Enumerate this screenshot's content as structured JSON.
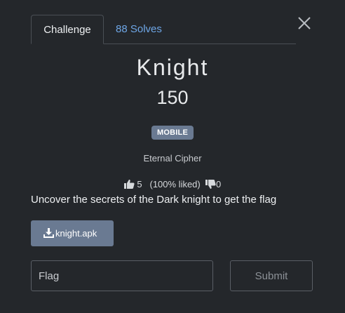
{
  "tabs": {
    "challenge_label": "Challenge",
    "solves_label": "88 Solves"
  },
  "challenge": {
    "name": "Knight",
    "points": "150",
    "tag": "MOBILE",
    "category": "Eternal Cipher",
    "likes": "5",
    "liked_text": "(100% liked)",
    "dislikes": "0",
    "description": "Uncover the secrets of the Dark knight to get the flag",
    "file_label": "knight.apk"
  },
  "form": {
    "flag_placeholder": "Flag",
    "submit_label": "Submit"
  },
  "icons": {
    "close": "close-icon",
    "thumbs_up": "thumbs-up-icon",
    "thumbs_down": "thumbs-down-icon",
    "download": "download-icon"
  },
  "colors": {
    "background": "#24272b",
    "link": "#6ea6e6",
    "badge": "#6a7a92",
    "file_button": "#6a7a92"
  }
}
